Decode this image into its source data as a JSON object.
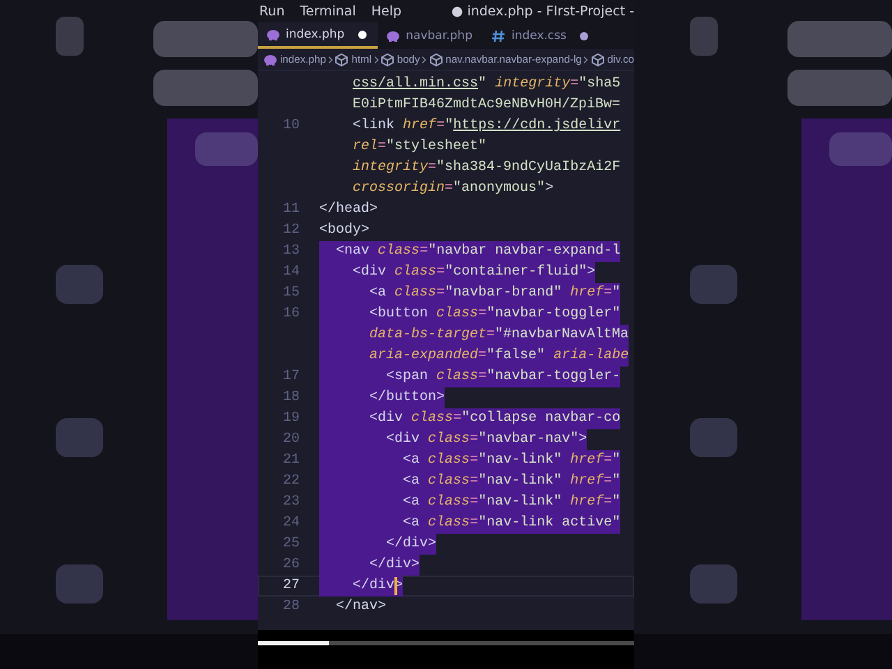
{
  "menu": [
    {
      "label": "Run"
    },
    {
      "label": "Terminal"
    },
    {
      "label": "Help"
    }
  ],
  "window": {
    "title": "● index.php - FIrst-Project -"
  },
  "tabs": [
    {
      "label": "index.php",
      "kind": "php",
      "selected": true,
      "modified": true
    },
    {
      "label": "navbar.php",
      "kind": "php",
      "selected": false,
      "modified": false
    },
    {
      "label": "index.css",
      "kind": "css",
      "selected": false,
      "modified": true
    }
  ],
  "breadcrumb": [
    {
      "label": "index.php",
      "kind": "php"
    },
    {
      "label": "html",
      "kind": "element"
    },
    {
      "label": "body",
      "kind": "element"
    },
    {
      "label": "nav.navbar.navbar-expand-lg",
      "kind": "element"
    },
    {
      "label": "div.co",
      "kind": "element"
    }
  ],
  "lines": [
    {
      "selected": false,
      "tokens": [
        {
          "kind": "url",
          "text": "    css/all.min.css"
        },
        {
          "kind": "str",
          "text": "\""
        },
        {
          "kind": "attr",
          "text": " integrity"
        },
        {
          "kind": "eq",
          "text": "="
        },
        {
          "kind": "str",
          "text": "\"sha5"
        }
      ]
    },
    {
      "selected": false,
      "tokens": [
        {
          "kind": "str",
          "text": "    E0iPtmFIB46ZmdtAc9eNBvH0H/ZpiBw="
        }
      ]
    },
    {
      "number": "10",
      "selected": false,
      "current": false,
      "tokens": [
        {
          "kind": "tag",
          "text": "    <link"
        },
        {
          "kind": "attr",
          "text": " href"
        },
        {
          "kind": "eq",
          "text": "="
        },
        {
          "kind": "str",
          "text": "\""
        },
        {
          "kind": "url",
          "text": "https://cdn.jsdelivr"
        }
      ]
    },
    {
      "selected": false,
      "tokens": [
        {
          "kind": "attr",
          "text": "    rel"
        },
        {
          "kind": "eq",
          "text": "="
        },
        {
          "kind": "str",
          "text": "\"stylesheet\""
        }
      ]
    },
    {
      "selected": false,
      "tokens": [
        {
          "kind": "attr",
          "text": "    integrity"
        },
        {
          "kind": "eq",
          "text": "="
        },
        {
          "kind": "str",
          "text": "\"sha384-9ndCyUaIbzAi2F"
        }
      ]
    },
    {
      "selected": false,
      "tokens": [
        {
          "kind": "attr",
          "text": "    crossorigin"
        },
        {
          "kind": "eq",
          "text": "="
        },
        {
          "kind": "str",
          "text": "\"anonymous\""
        },
        {
          "kind": "tag",
          "text": ">"
        }
      ]
    },
    {
      "number": "11",
      "selected": false,
      "current": false,
      "tokens": [
        {
          "kind": "tag",
          "text": "</head>"
        }
      ]
    },
    {
      "number": "12",
      "selected": false,
      "current": false,
      "tokens": [
        {
          "kind": "tag",
          "text": "<body>"
        }
      ]
    },
    {
      "number": "13",
      "selected": true,
      "current": false,
      "tokens": [
        {
          "kind": "tag",
          "text": "  <nav"
        },
        {
          "kind": "attr",
          "text": " class"
        },
        {
          "kind": "eq",
          "text": "="
        },
        {
          "kind": "str",
          "text": "\"navbar navbar-expand-l"
        }
      ]
    },
    {
      "number": "14",
      "selected": true,
      "current": false,
      "tokens": [
        {
          "kind": "tag",
          "text": "    <div"
        },
        {
          "kind": "attr",
          "text": " class"
        },
        {
          "kind": "eq",
          "text": "="
        },
        {
          "kind": "str",
          "text": "\"container-fluid\""
        },
        {
          "kind": "tag",
          "text": ">"
        }
      ]
    },
    {
      "number": "15",
      "selected": true,
      "current": false,
      "tokens": [
        {
          "kind": "tag",
          "text": "      <a"
        },
        {
          "kind": "attr",
          "text": " class"
        },
        {
          "kind": "eq",
          "text": "="
        },
        {
          "kind": "str",
          "text": "\"navbar-brand\""
        },
        {
          "kind": "attr",
          "text": " href"
        },
        {
          "kind": "eq",
          "text": "="
        },
        {
          "kind": "str",
          "text": "\""
        }
      ]
    },
    {
      "number": "16",
      "selected": true,
      "current": false,
      "tokens": [
        {
          "kind": "tag",
          "text": "      <button"
        },
        {
          "kind": "attr",
          "text": " class"
        },
        {
          "kind": "eq",
          "text": "="
        },
        {
          "kind": "str",
          "text": "\"navbar-toggler\""
        }
      ]
    },
    {
      "selected": true,
      "tokens": [
        {
          "kind": "attr",
          "text": "      data-bs-target"
        },
        {
          "kind": "eq",
          "text": "="
        },
        {
          "kind": "str",
          "text": "\"#navbarNavAltMa"
        }
      ]
    },
    {
      "selected": true,
      "tokens": [
        {
          "kind": "attr",
          "text": "      aria-expanded"
        },
        {
          "kind": "eq",
          "text": "="
        },
        {
          "kind": "str",
          "text": "\"false\""
        },
        {
          "kind": "attr",
          "text": " aria-labe"
        }
      ]
    },
    {
      "number": "17",
      "selected": true,
      "current": false,
      "tokens": [
        {
          "kind": "tag",
          "text": "        <span"
        },
        {
          "kind": "attr",
          "text": " class"
        },
        {
          "kind": "eq",
          "text": "="
        },
        {
          "kind": "str",
          "text": "\"navbar-toggler-"
        }
      ]
    },
    {
      "number": "18",
      "selected": true,
      "current": false,
      "tokens": [
        {
          "kind": "tag",
          "text": "      </button>"
        }
      ]
    },
    {
      "number": "19",
      "selected": true,
      "current": false,
      "tokens": [
        {
          "kind": "tag",
          "text": "      <div"
        },
        {
          "kind": "attr",
          "text": " class"
        },
        {
          "kind": "eq",
          "text": "="
        },
        {
          "kind": "str",
          "text": "\"collapse navbar-co"
        }
      ]
    },
    {
      "number": "20",
      "selected": true,
      "current": false,
      "tokens": [
        {
          "kind": "tag",
          "text": "        <div"
        },
        {
          "kind": "attr",
          "text": " class"
        },
        {
          "kind": "eq",
          "text": "="
        },
        {
          "kind": "str",
          "text": "\"navbar-nav\""
        },
        {
          "kind": "tag",
          "text": ">"
        }
      ]
    },
    {
      "number": "21",
      "selected": true,
      "current": false,
      "tokens": [
        {
          "kind": "tag",
          "text": "          <a"
        },
        {
          "kind": "attr",
          "text": " class"
        },
        {
          "kind": "eq",
          "text": "="
        },
        {
          "kind": "str",
          "text": "\"nav-link\""
        },
        {
          "kind": "attr",
          "text": " href"
        },
        {
          "kind": "eq",
          "text": "="
        },
        {
          "kind": "str",
          "text": "\""
        }
      ]
    },
    {
      "number": "22",
      "selected": true,
      "current": false,
      "tokens": [
        {
          "kind": "tag",
          "text": "          <a"
        },
        {
          "kind": "attr",
          "text": " class"
        },
        {
          "kind": "eq",
          "text": "="
        },
        {
          "kind": "str",
          "text": "\"nav-link\""
        },
        {
          "kind": "attr",
          "text": " href"
        },
        {
          "kind": "eq",
          "text": "="
        },
        {
          "kind": "str",
          "text": "\""
        }
      ]
    },
    {
      "number": "23",
      "selected": true,
      "current": false,
      "tokens": [
        {
          "kind": "tag",
          "text": "          <a"
        },
        {
          "kind": "attr",
          "text": " class"
        },
        {
          "kind": "eq",
          "text": "="
        },
        {
          "kind": "str",
          "text": "\"nav-link\""
        },
        {
          "kind": "attr",
          "text": " href"
        },
        {
          "kind": "eq",
          "text": "="
        },
        {
          "kind": "str",
          "text": "\""
        }
      ]
    },
    {
      "number": "24",
      "selected": true,
      "current": false,
      "tokens": [
        {
          "kind": "tag",
          "text": "          <a"
        },
        {
          "kind": "attr",
          "text": " class"
        },
        {
          "kind": "eq",
          "text": "="
        },
        {
          "kind": "str",
          "text": "\"nav-link active\""
        }
      ]
    },
    {
      "number": "25",
      "selected": true,
      "current": false,
      "tokens": [
        {
          "kind": "tag",
          "text": "        </div>"
        }
      ]
    },
    {
      "number": "26",
      "selected": true,
      "current": false,
      "tokens": [
        {
          "kind": "tag",
          "text": "      </div>"
        }
      ]
    },
    {
      "number": "27",
      "selected": true,
      "current": true,
      "tokens": [
        {
          "kind": "tag",
          "text": "    </div"
        },
        {
          "kind": "cursor"
        },
        {
          "kind": "tag",
          "text": ">"
        }
      ]
    },
    {
      "number": "28",
      "selected": false,
      "current": false,
      "tokens": [
        {
          "kind": "tag",
          "text": "  </nav>"
        }
      ]
    }
  ],
  "progress": {
    "level": 0.19
  }
}
